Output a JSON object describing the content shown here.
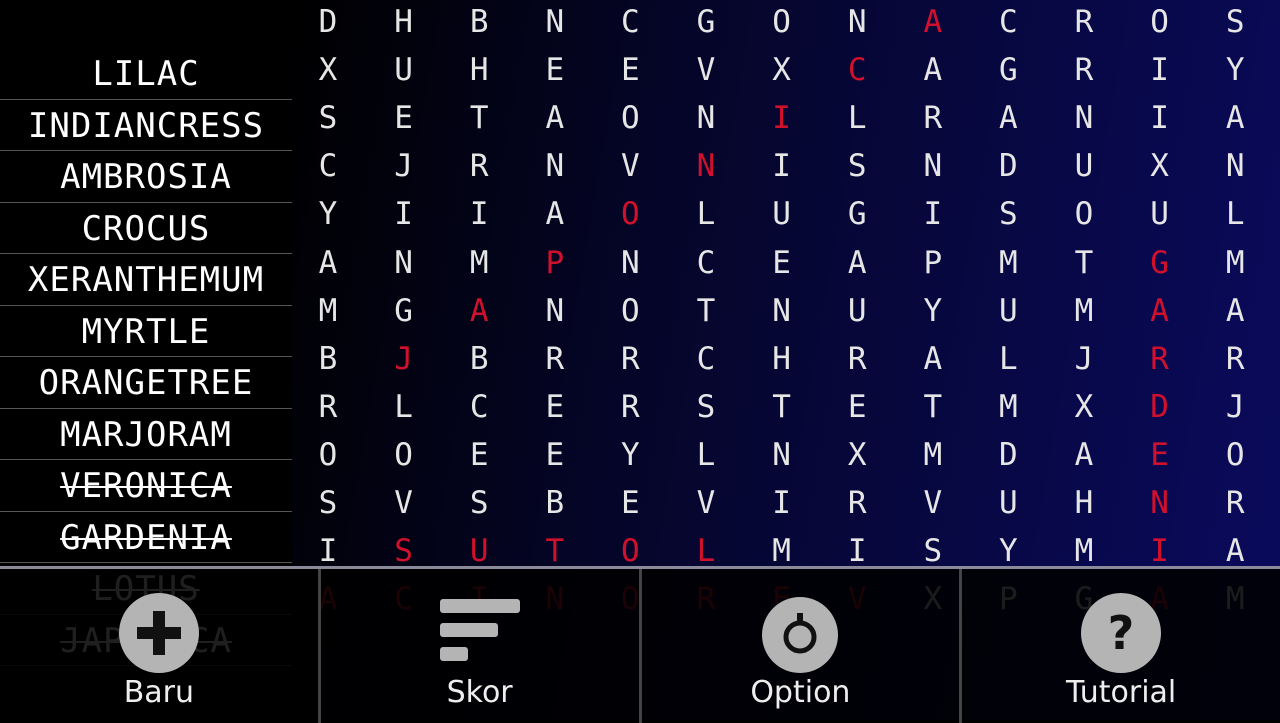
{
  "grid": {
    "rows": [
      "DHBNCGONACROS",
      "XUHEEVXCAGRIY",
      "SETAONILRANIA",
      "CJRNVNISNDUXN",
      "YIIAOLUGISOUL",
      "ANMPNCEAPMTGM",
      "MGANOTNUYUMAA",
      "BJBRRCHRALJRR",
      "RLCERSTETMXDJ",
      "OOEEYLNXMDAEO",
      "SVSBEVIRVUHNR",
      "ISUTOLMISYMIA",
      "ACINOREVXPGAM"
    ],
    "found_cells": [
      [
        0,
        8
      ],
      [
        1,
        7
      ],
      [
        2,
        6
      ],
      [
        3,
        5
      ],
      [
        4,
        4
      ],
      [
        5,
        3
      ],
      [
        6,
        2
      ],
      [
        7,
        1
      ],
      [
        5,
        11
      ],
      [
        6,
        11
      ],
      [
        7,
        11
      ],
      [
        8,
        11
      ],
      [
        9,
        11
      ],
      [
        10,
        11
      ],
      [
        11,
        11
      ],
      [
        12,
        11
      ],
      [
        11,
        1
      ],
      [
        11,
        2
      ],
      [
        11,
        3
      ],
      [
        11,
        4
      ],
      [
        11,
        5
      ],
      [
        12,
        0
      ],
      [
        12,
        1
      ],
      [
        12,
        2
      ],
      [
        12,
        3
      ],
      [
        12,
        4
      ],
      [
        12,
        5
      ],
      [
        12,
        6
      ],
      [
        12,
        7
      ]
    ],
    "found_color": "#d0102c",
    "letter_color": "#e6e6e6"
  },
  "words": [
    {
      "text": "LILAC",
      "found": false
    },
    {
      "text": "INDIANCRESS",
      "found": false
    },
    {
      "text": "AMBROSIA",
      "found": false
    },
    {
      "text": "CROCUS",
      "found": false
    },
    {
      "text": "XERANTHEMUM",
      "found": false
    },
    {
      "text": "MYRTLE",
      "found": false
    },
    {
      "text": "ORANGETREE",
      "found": false
    },
    {
      "text": "MARJORAM",
      "found": false
    },
    {
      "text": "VERONICA",
      "found": true
    },
    {
      "text": "GARDENIA",
      "found": true
    },
    {
      "text": "LOTUS",
      "found": true
    },
    {
      "text": "JAPONICA",
      "found": true
    }
  ],
  "menu": [
    {
      "label": "Baru",
      "icon": "plus-icon"
    },
    {
      "label": "Skor",
      "icon": "score-bars-icon"
    },
    {
      "label": "Option",
      "icon": "settings-dial-icon"
    },
    {
      "label": "Tutorial",
      "icon": "help-icon"
    }
  ]
}
